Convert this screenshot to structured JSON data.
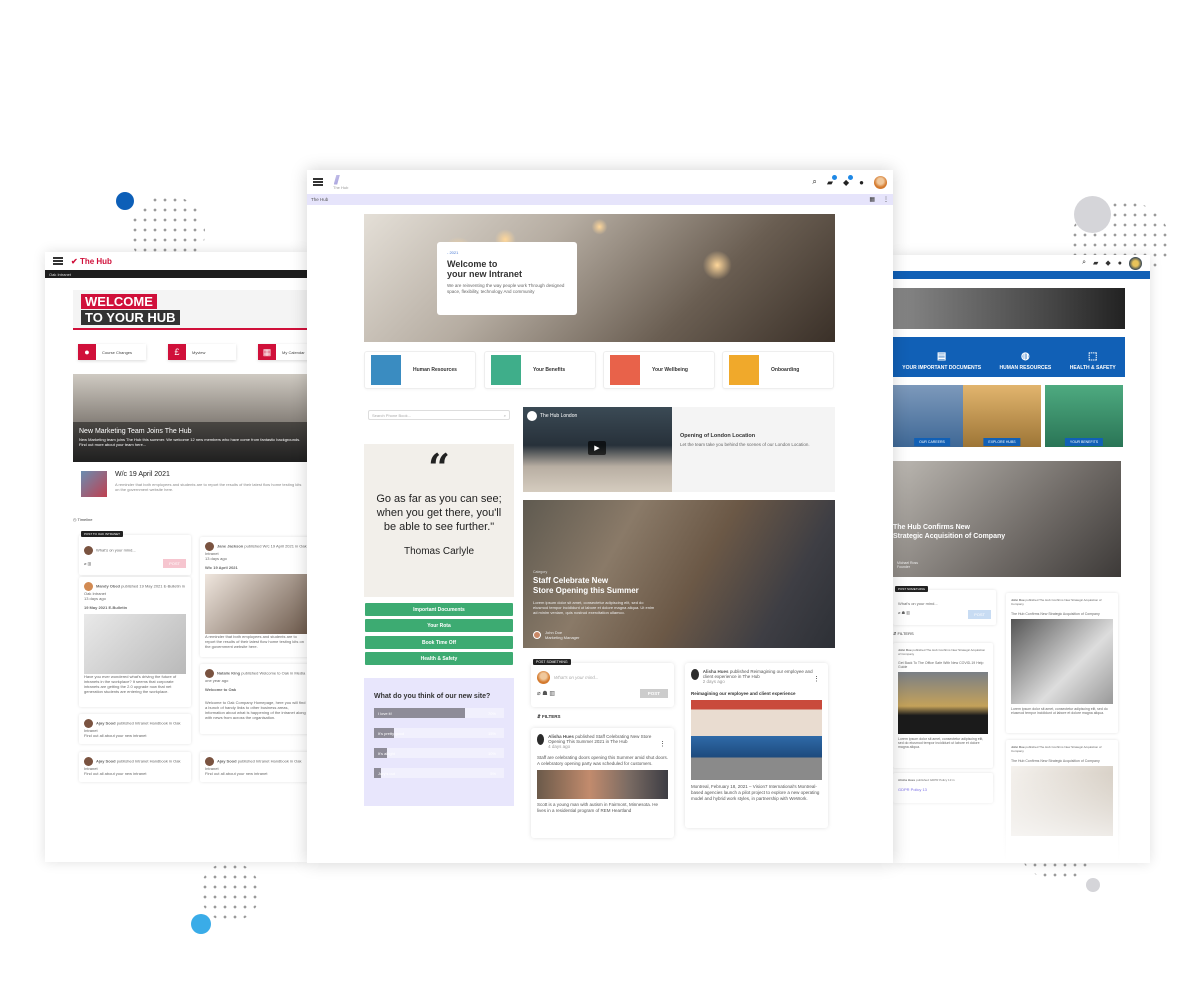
{
  "decor": {
    "colors": {
      "blue_dot": "#0d5fb8",
      "light_blue_dot": "#3aace8",
      "grey_dot": "#d5d5d9"
    }
  },
  "left_screen": {
    "brand": "The Hub",
    "breadcrumb": "Oak Intranet",
    "welcome_line1": "WELCOME",
    "welcome_line2": "TO YOUR HUB",
    "quick_links": [
      {
        "label": "Course Changes",
        "icon": "user-icon"
      },
      {
        "label": "Myview",
        "icon": "pound-icon"
      },
      {
        "label": "My Calendar",
        "icon": "calendar-icon"
      }
    ],
    "hero": {
      "title": "New Marketing Team Joins The Hub",
      "summary": "New Marketing team joins The Hub this summer. We welcome 12 new members who have come from fantastic backgrounds. Find out more about your team here..."
    },
    "week": {
      "title": "W/c 19 April 2021",
      "summary": "A reminder that both employees and students are to report the results of their latest flow home testing kits on the government website here."
    },
    "timeline_label": "Timeline",
    "post_box": {
      "tag": "POST TO OAK INTRANET",
      "placeholder": "What's on your mind...",
      "button": "POST"
    },
    "posts": [
      {
        "author": "Mandy Obed",
        "action": "published 19 May 2021 E-Bulletin in Oak Intranet",
        "time": "13 days ago",
        "title": "19 May 2021 E-Bulletin",
        "body": "Have you ever wondered what's driving the future of intranets in the workplace? It seems that corporate intranets are getting the 2.0 upgrade now that net generation students are entering the workplace."
      },
      {
        "author": "Jane Jackson",
        "action": "published W/c 19 April 2021 in Oak Intranet",
        "time": "13 days ago",
        "title": "W/c 19 April 2021",
        "body": "A reminder that both employees and students are to report the results of their latest flow home testing kits on the government website here."
      },
      {
        "author": "Natalie King",
        "action": "published Welcome to Oak in Media",
        "time": "one year ago",
        "title": "Welcome to Oak",
        "body": "Welcome to Oak Company Homepage, here you will find a bunch of handy links to other business areas, information about what is happening of the intranet along with news from across the organisation."
      },
      {
        "author": "Ajay Sood",
        "action": "published Intranet Handbook in Oak Intranet",
        "time": "2 years ago",
        "body": "Find out all about your new intranet"
      },
      {
        "author": "Ajay Sood",
        "action": "published Intranet Handbook in Oak Intranet",
        "time": "2 years ago",
        "body": "Find out all about your new intranet"
      },
      {
        "author": "Ajay Sood",
        "action": "published Intranet Handbook in Oak Intranet",
        "time": "2 years ago",
        "body": "Find out all about your new intranet"
      }
    ]
  },
  "center_screen": {
    "logo_text": "The Hub",
    "breadcrumb": "The Hub",
    "header_icons": {
      "message_badge": "1",
      "notification_badge": "1"
    },
    "hero": {
      "year": "- 2021",
      "title_line1": "Welcome to",
      "title_line2": "your new Intranet",
      "subtitle": "We are reinventing the way people work Through designed space, flexibility, technology And community"
    },
    "quick_tiles": [
      {
        "label": "Human Resources",
        "color": "#3a8cc1"
      },
      {
        "label": "Your Benefits",
        "color": "#3fae8a"
      },
      {
        "label": "Your Wellbeing",
        "color": "#e8624a"
      },
      {
        "label": "Onboarding",
        "color": "#f0a92b"
      }
    ],
    "phonebook_placeholder": "Search Phone Book...",
    "quote": {
      "mark": "“",
      "text": "Go as far as you can see; when you get there, you'll be able to see further.\"",
      "author": "Thomas Carlyle"
    },
    "green_buttons": [
      "Important Documents",
      "Your Rota",
      "Book Time Off",
      "Health & Safety"
    ],
    "poll": {
      "question": "What do you think of our new site?",
      "options": [
        {
          "label": "I love it!",
          "percent": 70
        },
        {
          "label": "It's pretty good",
          "percent": 15
        },
        {
          "label": "It's alright",
          "percent": 10
        },
        {
          "label": "Jury's out",
          "percent": 5
        }
      ]
    },
    "video": {
      "channel": "The Hub London",
      "title": "Opening of London Location",
      "description": "Let the team take you behind the scenes of our London Location."
    },
    "story": {
      "category": "Category",
      "title_line1": "Staff Celebrate New",
      "title_line2": "Store Opening this Summer",
      "summary": "Lorem ipsum dolor sit amet, consectetur adipiscing elit, sed do eiusmod tempor incididunt ut labore et dolore magna aliqua. Ut enim ad minim veniam, quis nostrud exercitation ullamco.",
      "author_name": "John Doe",
      "author_role": "Marketing Manager"
    },
    "post_box": {
      "tag": "POST SOMETHING",
      "placeholder": "What's on your mind...",
      "button": "POST"
    },
    "filters_label": "FILTERS",
    "feed": [
      {
        "author": "Alisha Hues",
        "action": "published Staff Celebrating New Store Opening This Summer 2021 in The Hub",
        "time": "4 days ago",
        "text": "Staff are celebrating doors opening this Summer amid shut doors. A celebratory opening party was scheduled for customers.",
        "footer": "Scott is a young man with autism in Fairmont, Minnesota. He lives in a residential program of REM Heartland"
      },
      {
        "author": "Alisha Hues",
        "action": "published Reimagining our employee and client experience in The Hub",
        "time": "2 days ago",
        "title": "Reimagining our employee and client experience",
        "text": "Montreal, February 18, 2021 – Vision7 International's Montreal-based agencies launch a pilot project to explore a new operating model and hybrid work styles, in partnership with WeWork."
      }
    ]
  },
  "right_screen": {
    "header_icons": {
      "message_badge": "1",
      "notification_badge": "1"
    },
    "blue_links": [
      "YOUR IMPORTANT DOCUMENTS",
      "HUMAN RESOURCES",
      "HEALTH & SAFETY"
    ],
    "tiles": [
      "OUR CAREERS",
      "EXPLORE HUBS",
      "YOUR BENEFITS"
    ],
    "hero": {
      "title_line1": "The Hub Confirms New",
      "title_line2": "Strategic Acquisition of Company",
      "author": "Michael Ross",
      "role": "Founder"
    },
    "post_box": {
      "tag": "POST SOMETHING",
      "placeholder": "What's on your mind...",
      "button": "POST"
    },
    "filters_label": "FILTERS",
    "posts": [
      {
        "author": "John Doe",
        "action": "published The Hub Confirms New Strategic Acquisition of Company",
        "time": "6 days ago",
        "title": "The Hub Confirms New Strategic Acquisition of Company"
      },
      {
        "author": "John Doe",
        "action": "published The Hub Confirms New Strategic Acquisition of Company",
        "time": "6 days ago",
        "title": "Get Back To The Office Safe With New COVID-19 Help Guide"
      },
      {
        "author": "John Doe",
        "action": "published The Hub Confirms New Strategic Acquisition of Company",
        "time": "6 days ago",
        "title": "The Hub Confirms New Strategic Acquisition of Company"
      },
      {
        "author": "Alisha Hues",
        "action": "published GDPR Policy 13 in",
        "time": "13 days ago",
        "attachment": "GDPR Policy 13"
      }
    ],
    "lorem": "Lorem ipsum dolor sit amet, consectetur adipiscing elit, sed do eiusmod tempor incididunt ut labore et dolore magna aliqua."
  }
}
